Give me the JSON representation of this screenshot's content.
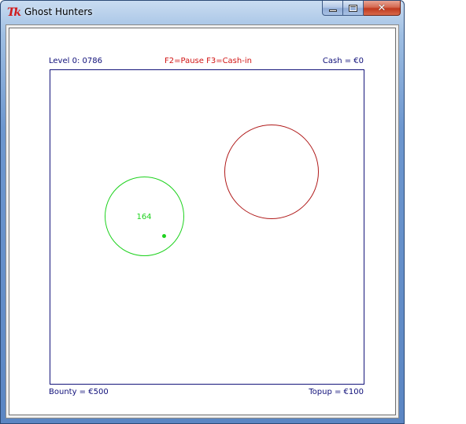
{
  "window": {
    "title": "Ghost Hunters",
    "icon": "tk-icon",
    "buttons": {
      "minimize": "minimize-icon",
      "maximize": "maximize-icon",
      "close": "close-icon",
      "close_glyph": "✕"
    }
  },
  "hud": {
    "level": "Level 0: 0786",
    "controls": "F2=Pause F3=Cash-in",
    "cash": "Cash = €0",
    "bounty": "Bounty = €500",
    "topup": "Topup = €100"
  },
  "ghosts": [
    {
      "label": "164",
      "color": "#1ed21e"
    },
    {
      "label": "",
      "color": "#b01a1a"
    }
  ],
  "colors": {
    "hud_text": "#10107a",
    "controls_text": "#d11414",
    "arena_border": "#14147a",
    "green_ghost": "#1ed21e",
    "red_ghost": "#b01a1a"
  }
}
